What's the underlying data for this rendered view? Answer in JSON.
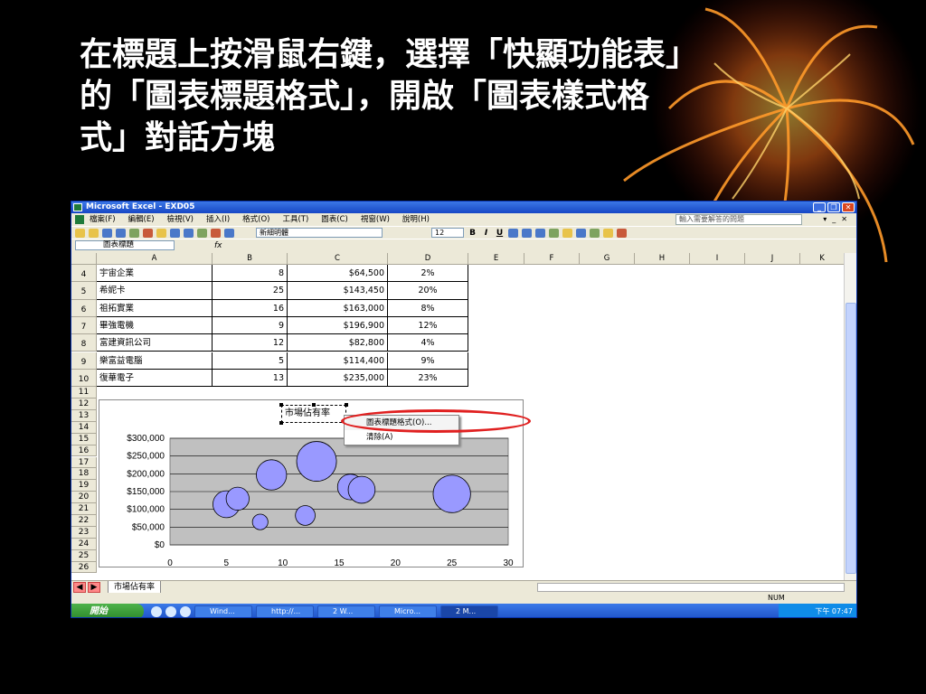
{
  "slide": {
    "title_lines": [
      "在標題上按滑鼠右鍵，選擇「快顯功能表」",
      "的「圖表標題格式」，開啟「圖表樣式格",
      "式」對話方塊"
    ]
  },
  "window": {
    "title": "Microsoft Excel - EXD05",
    "menu": [
      "檔案(F)",
      "編輯(E)",
      "檢視(V)",
      "插入(I)",
      "格式(O)",
      "工具(T)",
      "圖表(C)",
      "視窗(W)",
      "說明(H)"
    ],
    "help_placeholder": "輸入需要解答的問題",
    "font_name": "新細明體",
    "font_size": "12",
    "bold": "B",
    "italic": "I",
    "underline": "U",
    "name_box": "圖表標題",
    "fx": "fx"
  },
  "sheet": {
    "columns": [
      "A",
      "B",
      "C",
      "D",
      "E",
      "F",
      "G",
      "H",
      "I",
      "J",
      "K"
    ],
    "rows": [
      {
        "num": "4",
        "a": "宇宙企業",
        "b": "8",
        "c": "$64,500",
        "d": "2%"
      },
      {
        "num": "5",
        "a": "希妮卡",
        "b": "25",
        "c": "$143,450",
        "d": "20%"
      },
      {
        "num": "6",
        "a": "祖拓實業",
        "b": "16",
        "c": "$163,000",
        "d": "8%"
      },
      {
        "num": "7",
        "a": "畢強電機",
        "b": "9",
        "c": "$196,900",
        "d": "12%"
      },
      {
        "num": "8",
        "a": "富建資訊公司",
        "b": "12",
        "c": "$82,800",
        "d": "4%"
      },
      {
        "num": "9",
        "a": "樂富益電腦",
        "b": "5",
        "c": "$114,400",
        "d": "9%"
      },
      {
        "num": "10",
        "a": "復華電子",
        "b": "13",
        "c": "$235,000",
        "d": "23%"
      }
    ],
    "empty_rows": [
      "11",
      "12",
      "13",
      "14",
      "15",
      "16",
      "17",
      "18",
      "19",
      "20",
      "21",
      "22",
      "23",
      "24",
      "25",
      "26"
    ],
    "sheet_tab": "市場佔有率",
    "status": "NUM"
  },
  "chart_data": {
    "type": "scatter",
    "title": "市場佔有率",
    "xlabel": "",
    "ylabel": "",
    "xlim": [
      0,
      30
    ],
    "ylim": [
      0,
      300000
    ],
    "x_ticks": [
      "0",
      "5",
      "10",
      "15",
      "20",
      "25",
      "30"
    ],
    "y_ticks": [
      "$0",
      "$50,000",
      "$100,000",
      "$150,000",
      "$200,000",
      "$250,000",
      "$300,000"
    ],
    "grid": true,
    "series": [
      {
        "x": [
          8,
          25,
          16,
          9,
          12,
          5,
          13,
          6,
          17
        ],
        "y": [
          64500,
          143450,
          163000,
          196900,
          82800,
          114400,
          235000,
          130000,
          155000
        ],
        "size": [
          2,
          20,
          8,
          12,
          4,
          9,
          23,
          6,
          9
        ]
      }
    ],
    "colors": {
      "bubble": "#9999ff",
      "plot_bg": "#c0c0c0"
    }
  },
  "context_menu": {
    "items": [
      "圖表標題格式(O)...",
      "清除(A)"
    ]
  },
  "taskbar": {
    "start": "開始",
    "tasks": [
      "Wind...",
      "http://...",
      "2 W...",
      "Micro...",
      "2 M..."
    ],
    "clock": "下午 07:47"
  }
}
